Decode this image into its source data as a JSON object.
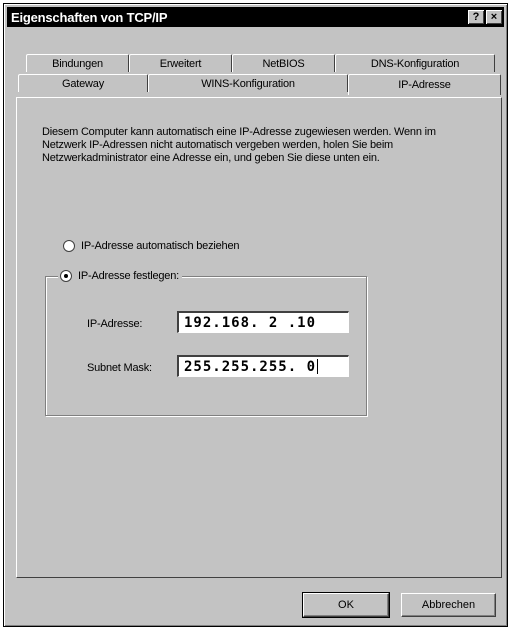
{
  "window": {
    "title": "Eigenschaften von TCP/IP",
    "help_label": "?",
    "close_label": "×"
  },
  "tabs": {
    "row1": [
      "Bindungen",
      "Erweitert",
      "NetBIOS",
      "DNS-Konfiguration"
    ],
    "row2": [
      "Gateway",
      "WINS-Konfiguration",
      "IP-Adresse"
    ],
    "active": "IP-Adresse"
  },
  "panel": {
    "description": "Diesem Computer kann automatisch eine IP-Adresse zugewiesen werden. Wenn im Netzwerk IP-Adressen nicht automatisch vergeben werden, holen Sie beim Netzwerkadministrator eine Adresse ein, und geben Sie diese unten ein.",
    "radio_auto": {
      "label": "IP-Adresse automatisch beziehen",
      "selected": false
    },
    "radio_manual": {
      "label": "IP-Adresse festlegen:",
      "selected": true
    },
    "ip_label": "IP-Adresse:",
    "ip_value": "192.168. 2 .10",
    "subnet_label": "Subnet Mask:",
    "subnet_value": "255.255.255. 0"
  },
  "buttons": {
    "ok": "OK",
    "cancel": "Abbrechen"
  }
}
